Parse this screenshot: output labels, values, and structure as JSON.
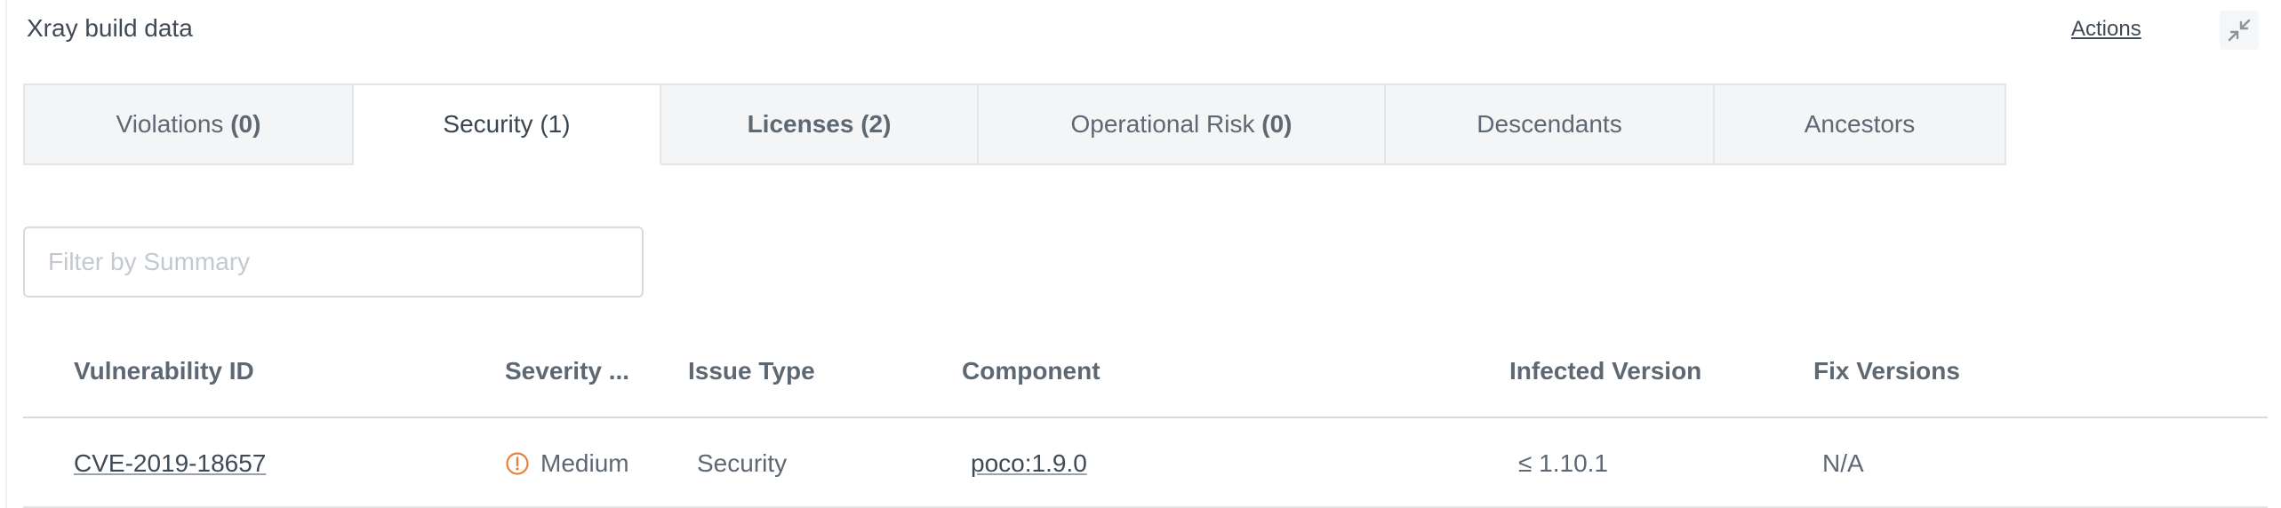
{
  "panel": {
    "title": "Xray build data",
    "actions_label": "Actions",
    "collapse_icon": "collapse-arrows-icon"
  },
  "tabs": [
    {
      "label": "Violations",
      "count": "(0)"
    },
    {
      "label": "Security",
      "count": "(1)"
    },
    {
      "label": "Licenses",
      "count": "(2)"
    },
    {
      "label": "Operational Risk",
      "count": "(0)"
    },
    {
      "label": "Descendants",
      "count": ""
    },
    {
      "label": "Ancestors",
      "count": ""
    }
  ],
  "active_tab": "Security",
  "filter": {
    "placeholder": "Filter by Summary",
    "value": ""
  },
  "table": {
    "columns": [
      "Vulnerability ID",
      "Severity ...",
      "Issue Type",
      "Component",
      "Infected Version",
      "Fix Versions"
    ],
    "rows": [
      {
        "vulnerability_id": "CVE-2019-18657",
        "severity": "Medium",
        "severity_icon": "warning-circle-icon",
        "issue_type": "Security",
        "component": "poco:1.9.0",
        "infected_version": "≤ 1.10.1",
        "fix_versions": "N/A"
      }
    ]
  },
  "colors": {
    "severity_medium": "#e8823a",
    "border": "#e3e6e9",
    "text": "#5d6873"
  }
}
